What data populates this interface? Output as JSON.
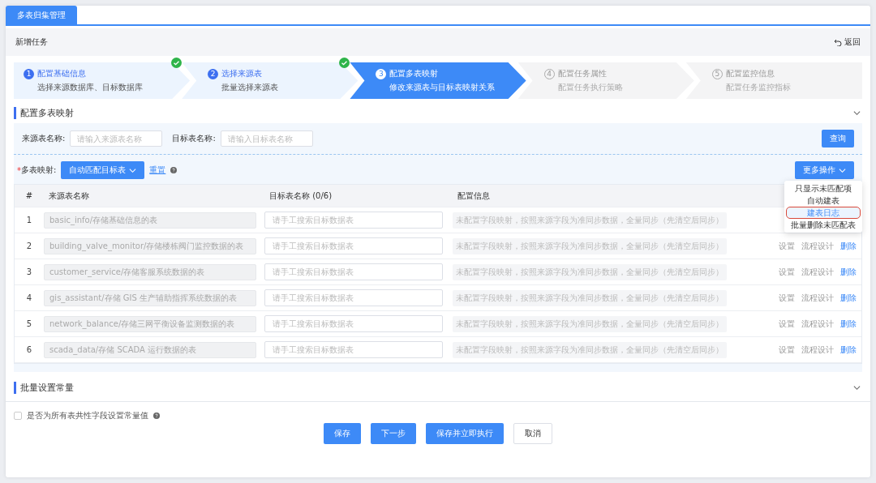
{
  "tabs": [
    {
      "label": "多表归集管理",
      "selected": true
    }
  ],
  "header": {
    "title": "新增任务",
    "back": "返回"
  },
  "steps": [
    {
      "number": "1",
      "title": "配置基础信息",
      "subtitle": "选择来源数据库、目标数据库",
      "kind": "done"
    },
    {
      "number": "2",
      "title": "选择来源表",
      "subtitle": "批量选择来源表",
      "kind": "done"
    },
    {
      "number": "3",
      "title": "配置多表映射",
      "subtitle": "修改来源表与目标表映射关系",
      "kind": "active"
    },
    {
      "number": "4",
      "title": "配置任务属性",
      "subtitle": "配置任务执行策略",
      "kind": "todo"
    },
    {
      "number": "5",
      "title": "配置监控信息",
      "subtitle": "配置任务监控指标",
      "kind": "todo"
    }
  ],
  "mapping_section": {
    "title": "配置多表映射",
    "expanded": true,
    "filters": [
      {
        "label": "来源表名称:",
        "placeholder": "请输入来源表名称"
      },
      {
        "label": "目标表名称:",
        "placeholder": "请输入目标表名称"
      }
    ],
    "query_button": "查询",
    "required_mark": "*",
    "mapping_label": "多表映射:",
    "auto_match_button": "自动匹配目标表",
    "reset_link": "重置",
    "more_button": "更多操作",
    "more_menu": [
      {
        "label": "只显示未匹配项",
        "selected": false
      },
      {
        "label": "自动建表",
        "selected": false
      },
      {
        "label": "建表日志",
        "selected": true
      },
      {
        "label": "批量删除未匹配表",
        "selected": false
      }
    ],
    "table": {
      "columns": [
        "#",
        "来源表名称",
        "目标表名称 (0/6)",
        "配置信息"
      ],
      "rows": [
        {
          "index": "1",
          "source": "basic_info/存储基础信息的表",
          "target_placeholder": "请手工搜索目标数据表",
          "config": "未配置字段映射，按照来源字段为准同步数据，全量同步（先清空后同步）"
        },
        {
          "index": "2",
          "source": "building_valve_monitor/存储楼栋阀门监控数据的表",
          "target_placeholder": "请手工搜索目标数据表",
          "config": "未配置字段映射，按照来源字段为准同步数据，全量同步（先清空后同步）",
          "actions": [
            "设置",
            "流程设计",
            "删除"
          ]
        },
        {
          "index": "3",
          "source": "customer_service/存储客服系统数据的表",
          "target_placeholder": "请手工搜索目标数据表",
          "config": "未配置字段映射，按照来源字段为准同步数据，全量同步（先清空后同步）",
          "actions": [
            "设置",
            "流程设计",
            "删除"
          ]
        },
        {
          "index": "4",
          "source": "gis_assistant/存储 GIS 生产辅助指挥系统数据的表",
          "target_placeholder": "请手工搜索目标数据表",
          "config": "未配置字段映射，按照来源字段为准同步数据，全量同步（先清空后同步）",
          "actions": [
            "设置",
            "流程设计",
            "删除"
          ]
        },
        {
          "index": "5",
          "source": "network_balance/存储三网平衡设备监测数据的表",
          "target_placeholder": "请手工搜索目标数据表",
          "config": "未配置字段映射，按照来源字段为准同步数据，全量同步（先清空后同步）",
          "actions": [
            "设置",
            "流程设计",
            "删除"
          ]
        },
        {
          "index": "6",
          "source": "scada_data/存储 SCADA 运行数据的表",
          "target_placeholder": "请手工搜索目标数据表",
          "config": "未配置字段映射，按照来源字段为准同步数据，全量同步（先清空后同步）",
          "actions": [
            "设置",
            "流程设计",
            "删除"
          ]
        }
      ]
    }
  },
  "constants_section": {
    "title": "批量设置常量",
    "expanded": false,
    "checkbox": {
      "label": "是否为所有表共性字段设置常量值",
      "checked": false
    }
  },
  "buttons": [
    {
      "label": "保存",
      "kind": "primary"
    },
    {
      "label": "下一步",
      "kind": "primary"
    },
    {
      "label": "保存并立即执行",
      "kind": "primary"
    },
    {
      "label": "取消",
      "kind": "default"
    }
  ]
}
